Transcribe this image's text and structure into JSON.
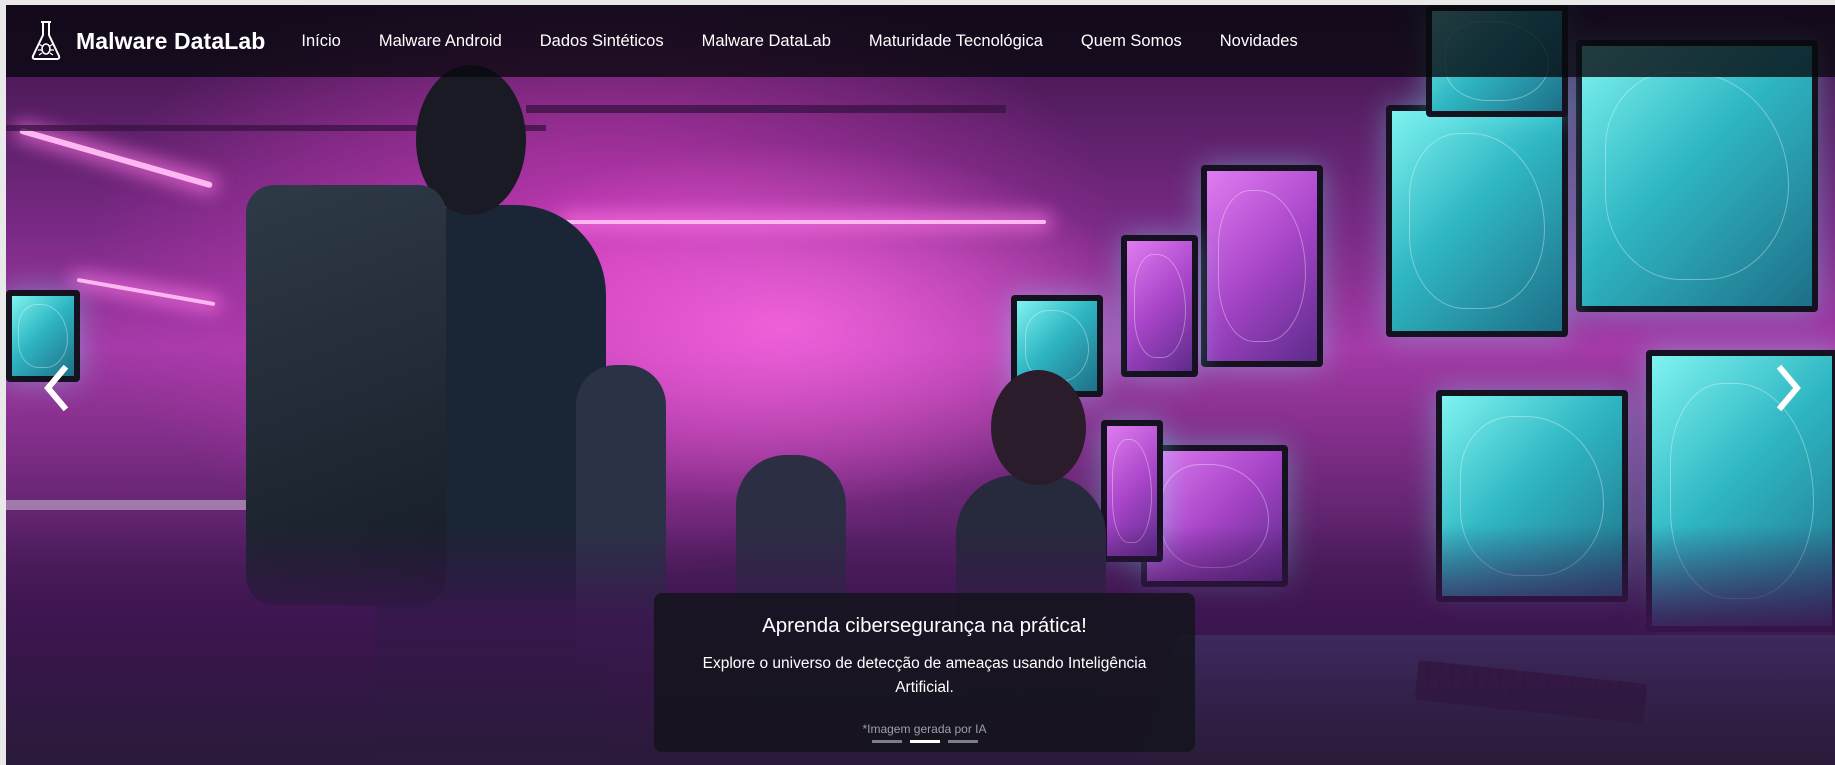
{
  "navbar": {
    "brand": {
      "icon": "flask-bug-icon",
      "label": "Malware DataLab"
    },
    "items": [
      {
        "label": "Início"
      },
      {
        "label": "Malware Android"
      },
      {
        "label": "Dados Sintéticos"
      },
      {
        "label": "Malware DataLab"
      },
      {
        "label": "Maturidade Tecnológica"
      },
      {
        "label": "Quem Somos"
      },
      {
        "label": "Novidades"
      }
    ]
  },
  "carousel": {
    "prev_icon": "chevron-left-icon",
    "next_icon": "chevron-right-icon",
    "slide": {
      "title": "Aprenda cibersegurança na prática!",
      "text": "Explore o universo de detecção de ameaças usando Inteligência Artificial.",
      "note": "*Imagem gerada por IA"
    },
    "indicators": {
      "count": 3,
      "active": 1
    }
  },
  "colors": {
    "navbar_bg": "#08080e",
    "accent_pink": "#c23fbf",
    "accent_teal": "#4fd3d9"
  }
}
